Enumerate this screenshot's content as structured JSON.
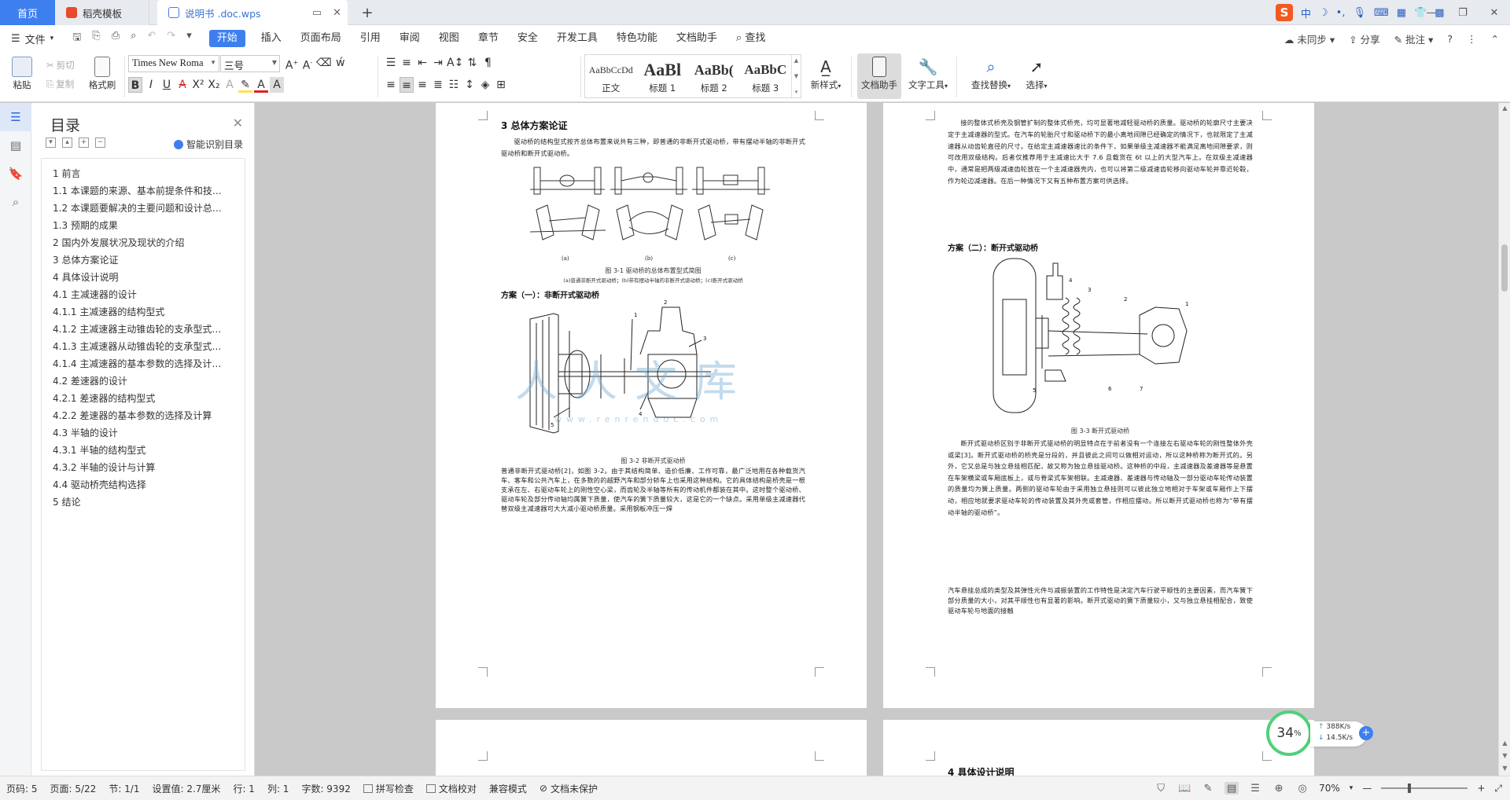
{
  "tabs": {
    "home": "首页",
    "shell": "稻壳模板",
    "doc": "说明书 .doc.wps"
  },
  "menubar": {
    "file": "文件",
    "tabs": [
      "开始",
      "插入",
      "页面布局",
      "引用",
      "审阅",
      "视图",
      "章节",
      "安全",
      "开发工具",
      "特色功能",
      "文档助手"
    ],
    "search": "查找",
    "sync": "未同步",
    "share": "分享",
    "comment": "批注"
  },
  "ribbon": {
    "paste": "粘贴",
    "cut": "剪切",
    "copy": "复制",
    "format_painter": "格式刷",
    "font_name": "Times New Roma",
    "font_size": "三号",
    "styles": [
      {
        "preview": "AaBbCcDd",
        "name": "正文"
      },
      {
        "preview": "AaBl",
        "name": "标题 1"
      },
      {
        "preview": "AaBb(",
        "name": "标题 2"
      },
      {
        "preview": "AaBbC",
        "name": "标题 3"
      }
    ],
    "new_style": "新样式",
    "doc_assistant": "文档助手",
    "text_tools": "文字工具",
    "find_replace": "查找替换",
    "select": "选择"
  },
  "toc": {
    "title": "目录",
    "smart": "智能识别目录",
    "items": [
      "1 前言",
      "1.1 本课题的来源、基本前提条件和技…",
      "1.2 本课题要解决的主要问题和设计总…",
      "1.3 预期的成果",
      "2 国内外发展状况及现状的介绍",
      "3 总体方案论证",
      "4 具体设计说明",
      "4.1 主减速器的设计",
      "4.1.1 主减速器的结构型式",
      "4.1.2 主减速器主动锥齿轮的支承型式…",
      "4.1.3 主减速器从动锥齿轮的支承型式…",
      "4.1.4 主减速器的基本参数的选择及计…",
      "4.2 差速器的设计",
      "4.2.1 差速器的结构型式",
      "4.2.2 差速器的基本参数的选择及计算",
      "4.3 半轴的设计",
      "4.3.1 半轴的结构型式",
      "4.3.2 半轴的设计与计算",
      "4.4 驱动桥壳结构选择",
      "5 结论"
    ]
  },
  "page1": {
    "heading": "3 总体方案论证",
    "intro": "驱动桥的结构型式按齐总体布置来说共有三种，即普通的非断开式驱动桥，带有摆动半轴的非断开式驱动桥和断开式驱动桥。",
    "fig_labels": [
      "(a)",
      "(b)",
      "(c)"
    ],
    "fig1_caption": "图 3-1    驱动桥的总体布置型式简图",
    "fig1_sub": "(a)普通非断开式驱动桥；(b)带有摆动半轴的非断开式驱动桥；(c)断开式驱动桥",
    "scheme1": "方案（一）：非断开式驱动桥",
    "fig2_caption": "图 3-2    非断开式驱动桥",
    "body": "普通非断开式驱动桥[2]，如图 3-2。由于其结构简单、造价低廉、工作可靠，最广泛地用在各种载货汽车、客车和公共汽车上，在多数的的越野汽车和部分轿车上也采用这种结构。它的具体结构是桥壳是一根支承在左、右驱动车轮上的刚性空心梁，而齿轮及半轴等所有的传动机件都装在其中。这时整个驱动桥、驱动车轮及部分传动轴均属簧下质量，使汽车的簧下质量较大，这是它的一个缺点。采用单级主减速器代替双级主减速器可大大减小驱动桥质量。采用钢板冲压一焊"
  },
  "page2": {
    "para_top": "接的整体式桥壳及钢管扩制的整体式桥壳，均可显著地减轻驱动桥的质量。驱动桥的轮廓尺寸主要决定于主减速器的型式。在汽车的轮胎尺寸和驱动桥下的最小离地间隙已经确定的情况下，也就限定了主减速器从动齿轮直径的尺寸。在给定主减速器速比的条件下，如果单级主减速器不能满足离地间隙要求，则可改用双级结构。后者仅推荐用于主减速比大于 7.6 且载货在 6t 以上的大型汽车上。在双级主减速器中，通常是把两级减速齿轮放在一个主减速器壳内，也可以将第二级减速齿轮移向驱动车轮并靠近轮毂，作为轮边减速器。在后一种情况下又有五种布置方案可供选择。",
    "scheme2": "方案（二）：断开式驱动桥",
    "fig3_caption": "图 3-3    断开式驱动桥",
    "body": "断开式驱动桥区别于非断开式驱动桥的明显特点在于前者没有一个连接左右驱动车轮的刚性整体外壳或梁[3]。断开式驱动桥的桥壳是分段的，并且彼此之间可以做相对运动，所以这种桥称为断开式的。另外，它又总是与独立悬挂相匹配，故又称为独立悬挂驱动桥。这种桥的中段，主减速器及差速器等是悬置在车架横梁或车厢底板上，或与脊梁式车架相联。主减速器、差速器与传动轴及一部分驱动车轮传动装置的质量均为簧上质量。两侧的驱动车轮由于采用独立悬挂则可以彼此独立地相对于车架或车厢作上下摆动，相应地就要求驱动车轮的传动装置及其外壳或套管，作相应摆动。所以断开式驱动桥也称为“带有摆动半轴的驱动桥”。",
    "body2": "汽车悬挂总成的类型及其弹性元件与减振装置的工作特性是决定汽车行驶平顺性的主要因素，而汽车簧下部分质量的大小，对其平顺性也有显著的影响。断开式驱动的簧下质量较小，又与独立悬挂相配合，致使驱动车轮与地面的接触"
  },
  "page4": {
    "heading": "4 具体设计说明"
  },
  "watermark": {
    "text": "人人文库",
    "url": "www.renrendoc.com"
  },
  "speed": {
    "percent": "34",
    "up": "388K/s",
    "down": "14.5K/s"
  },
  "status": {
    "page_code": "页码: 5",
    "page": "页面: 5/22",
    "section": "节: 1/1",
    "setting": "设置值: 2.7厘米",
    "row": "行: 1",
    "col": "列: 1",
    "words": "字数: 9392",
    "spell": "拼写检查",
    "proof": "文档校对",
    "compat": "兼容模式",
    "protect": "文档未保护",
    "zoom": "70%"
  }
}
